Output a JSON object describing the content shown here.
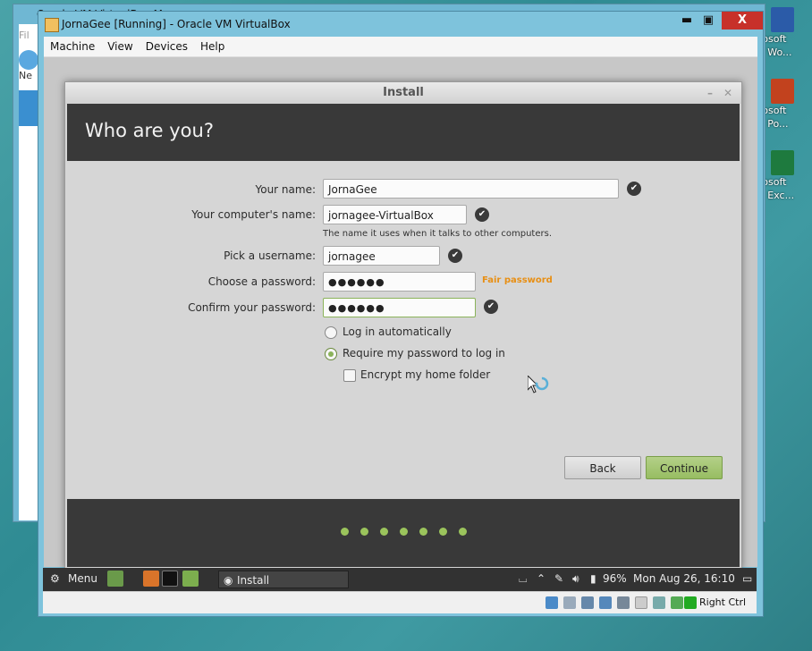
{
  "desktop": {
    "icons": [
      {
        "label_line1": "rosoft",
        "label_line2": "e Wo...",
        "color": "#2b5ba8"
      },
      {
        "label_line1": "rosoft",
        "label_line2": "e Po...",
        "color": "#c2421e"
      },
      {
        "label_line1": "rosoft",
        "label_line2": "e Exc...",
        "color": "#1e7a3e"
      }
    ]
  },
  "manager_window": {
    "title": "Oracle VM VirtualBox M...",
    "menu_partial": "Fil",
    "new_partial": "Ne"
  },
  "vm_window": {
    "title": "JornaGee [Running] - Oracle VM VirtualBox",
    "menu": [
      "Machine",
      "View",
      "Devices",
      "Help"
    ],
    "close_glyph": "X",
    "max_glyph": "▣",
    "min_glyph": "▬"
  },
  "installer": {
    "window_title": "Install",
    "heading": "Who are you?",
    "fields": {
      "name_label": "Your name:",
      "name_value": "JornaGee",
      "computer_label": "Your computer's name:",
      "computer_value": "jornagee-VirtualBox",
      "computer_hint": "The name it uses when it talks to other computers.",
      "username_label": "Pick a username:",
      "username_value": "jornagee",
      "password_label": "Choose a password:",
      "password_value": "●●●●●●",
      "password_strength": "Fair password",
      "confirm_label": "Confirm your password:",
      "confirm_value": "●●●●●●"
    },
    "options": {
      "auto_login": "Log in automatically",
      "require_password": "Require my password to log in",
      "encrypt_home": "Encrypt my home folder",
      "selected": "require_password",
      "encrypt_checked": false
    },
    "buttons": {
      "back": "Back",
      "continue": "Continue"
    },
    "progress_dots": 7,
    "accent": "#9bc45c",
    "strength_color": "#e88f14"
  },
  "taskbar": {
    "menu_label": "Menu",
    "install_item": "Install",
    "battery": "96%",
    "clock": "Mon Aug 26, 16:10"
  },
  "statusbar": {
    "host_key": "Right Ctrl"
  }
}
